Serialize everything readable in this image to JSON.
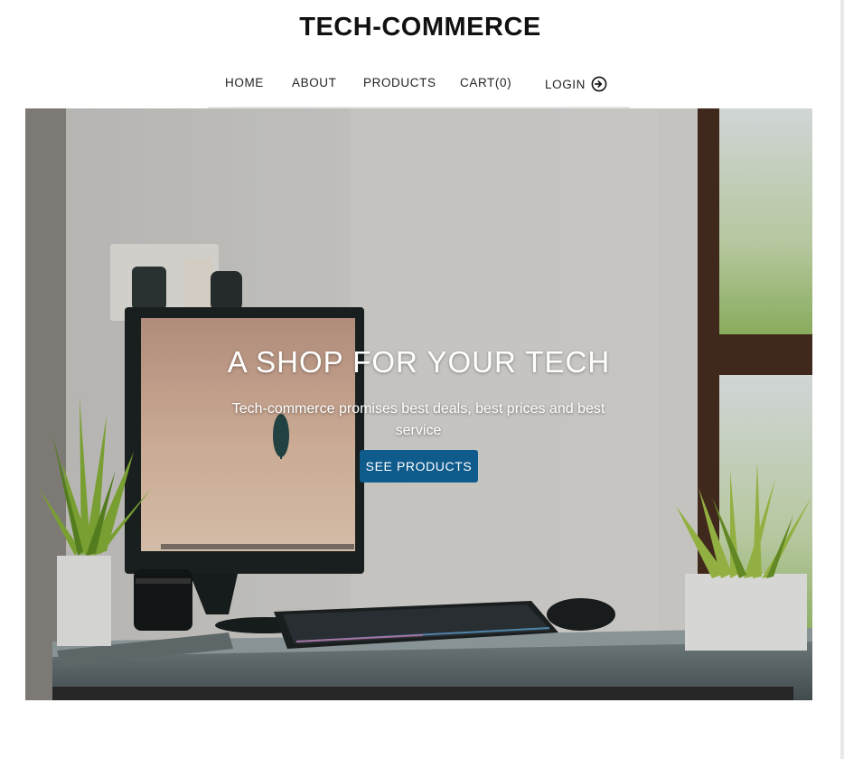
{
  "site": {
    "title": "TECH-COMMERCE"
  },
  "nav": {
    "home": "HOME",
    "about": "ABOUT",
    "products": "PRODUCTS",
    "cart": "CART(0)",
    "login": "LOGIN",
    "login_icon": "login-arrow-icon"
  },
  "hero": {
    "heading": "A SHOP FOR YOUR TECH",
    "subtext": "Tech-commerce promises best deals, best prices and best service",
    "button_label": "SEE PRODUCTS",
    "image": "desk-with-monitor-keyboard-and-plants"
  },
  "colors": {
    "button": "#0f5b8c",
    "text": "#111111",
    "hero_text": "#ffffff"
  }
}
